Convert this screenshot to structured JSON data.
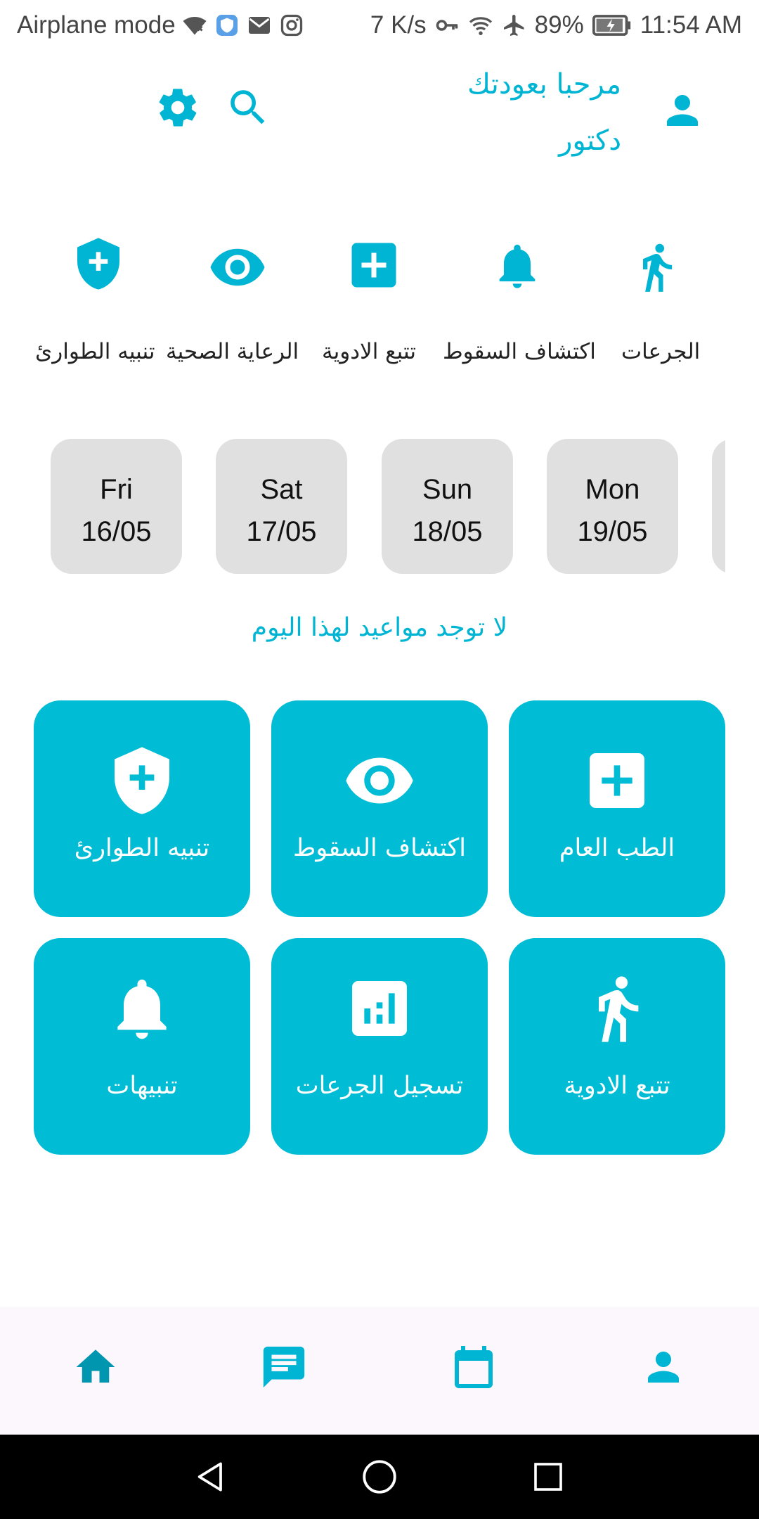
{
  "status_bar": {
    "mode": "Airplane mode",
    "speed": "7 K/s",
    "battery": "89%",
    "time": "11:54 AM"
  },
  "header": {
    "welcome": "مرحبا بعودتك",
    "role": "دكتور",
    "icons": [
      "gear-icon",
      "search-icon",
      "person-icon"
    ]
  },
  "quick_links": [
    {
      "label": "الجرعات",
      "icon": "run-icon"
    },
    {
      "label": "اكتشاف السقوط",
      "icon": "bell-icon"
    },
    {
      "label": "تتبع الادوية",
      "icon": "medical-plus-icon"
    },
    {
      "label": "الرعاية الصحية",
      "icon": "eye-icon"
    },
    {
      "label": "تنبيه الطوارئ",
      "icon": "shield-plus-icon"
    }
  ],
  "dates": [
    {
      "day": "Fri",
      "date": "16/05"
    },
    {
      "day": "Sat",
      "date": "17/05"
    },
    {
      "day": "Sun",
      "date": "18/05"
    },
    {
      "day": "Mon",
      "date": "19/05"
    }
  ],
  "no_appointments": "لا توجد مواعيد لهذا اليوم",
  "tiles": [
    {
      "label": "الطب العام",
      "icon": "medical-plus-icon"
    },
    {
      "label": "اكتشاف السقوط",
      "icon": "eye-icon"
    },
    {
      "label": "تنبيه الطوارئ",
      "icon": "shield-plus-icon"
    },
    {
      "label": "تتبع الادوية",
      "icon": "run-icon"
    },
    {
      "label": "تسجيل الجرعات",
      "icon": "chart-icon"
    },
    {
      "label": "تنبيهات",
      "icon": "bell-icon"
    }
  ],
  "bottom_nav": [
    "home-icon",
    "chat-icon",
    "calendar-icon",
    "profile-icon"
  ],
  "colors": {
    "accent": "#00b5d3",
    "tile": "#00bcd4",
    "date_card": "#e0e0e0",
    "nav_bg": "#fcf7fc"
  }
}
